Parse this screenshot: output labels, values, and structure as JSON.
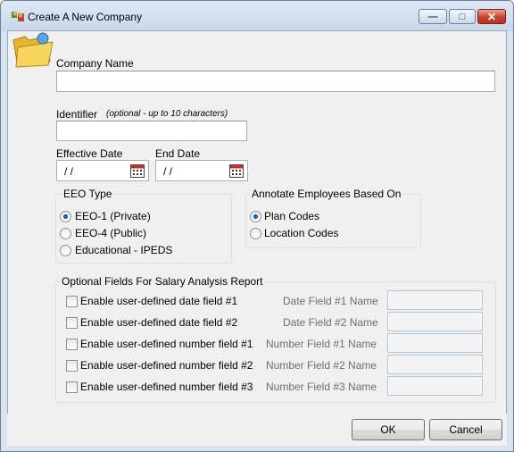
{
  "window": {
    "title": "Create A New Company"
  },
  "company_name": {
    "label": "Company Name",
    "value": ""
  },
  "identifier": {
    "label": "Identifier",
    "hint": "(optional - up to 10 characters)",
    "value": ""
  },
  "effective_date": {
    "label": "Effective Date",
    "value": " / /"
  },
  "end_date": {
    "label": "End Date",
    "value": " / /"
  },
  "eeo_type": {
    "title": "EEO Type",
    "options": [
      {
        "label": "EEO-1 (Private)",
        "checked": true
      },
      {
        "label": "EEO-4 (Public)",
        "checked": false
      },
      {
        "label": "Educational - IPEDS",
        "checked": false
      }
    ]
  },
  "annotate": {
    "title": "Annotate Employees Based On",
    "options": [
      {
        "label": "Plan Codes",
        "checked": true
      },
      {
        "label": "Location Codes",
        "checked": false
      }
    ]
  },
  "optional_fields": {
    "title": "Optional Fields For Salary Analysis Report",
    "rows": [
      {
        "label": "Enable user-defined date field #1",
        "name_label": "Date Field #1 Name",
        "checked": false,
        "value": ""
      },
      {
        "label": "Enable user-defined date field #2",
        "name_label": "Date Field #2 Name",
        "checked": false,
        "value": ""
      },
      {
        "label": "Enable user-defined number field #1",
        "name_label": "Number Field #1 Name",
        "checked": false,
        "value": ""
      },
      {
        "label": "Enable user-defined number field #2",
        "name_label": "Number Field #2 Name",
        "checked": false,
        "value": ""
      },
      {
        "label": "Enable user-defined number field #3",
        "name_label": "Number Field #3 Name",
        "checked": false,
        "value": ""
      }
    ]
  },
  "buttons": {
    "ok": "OK",
    "cancel": "Cancel"
  }
}
